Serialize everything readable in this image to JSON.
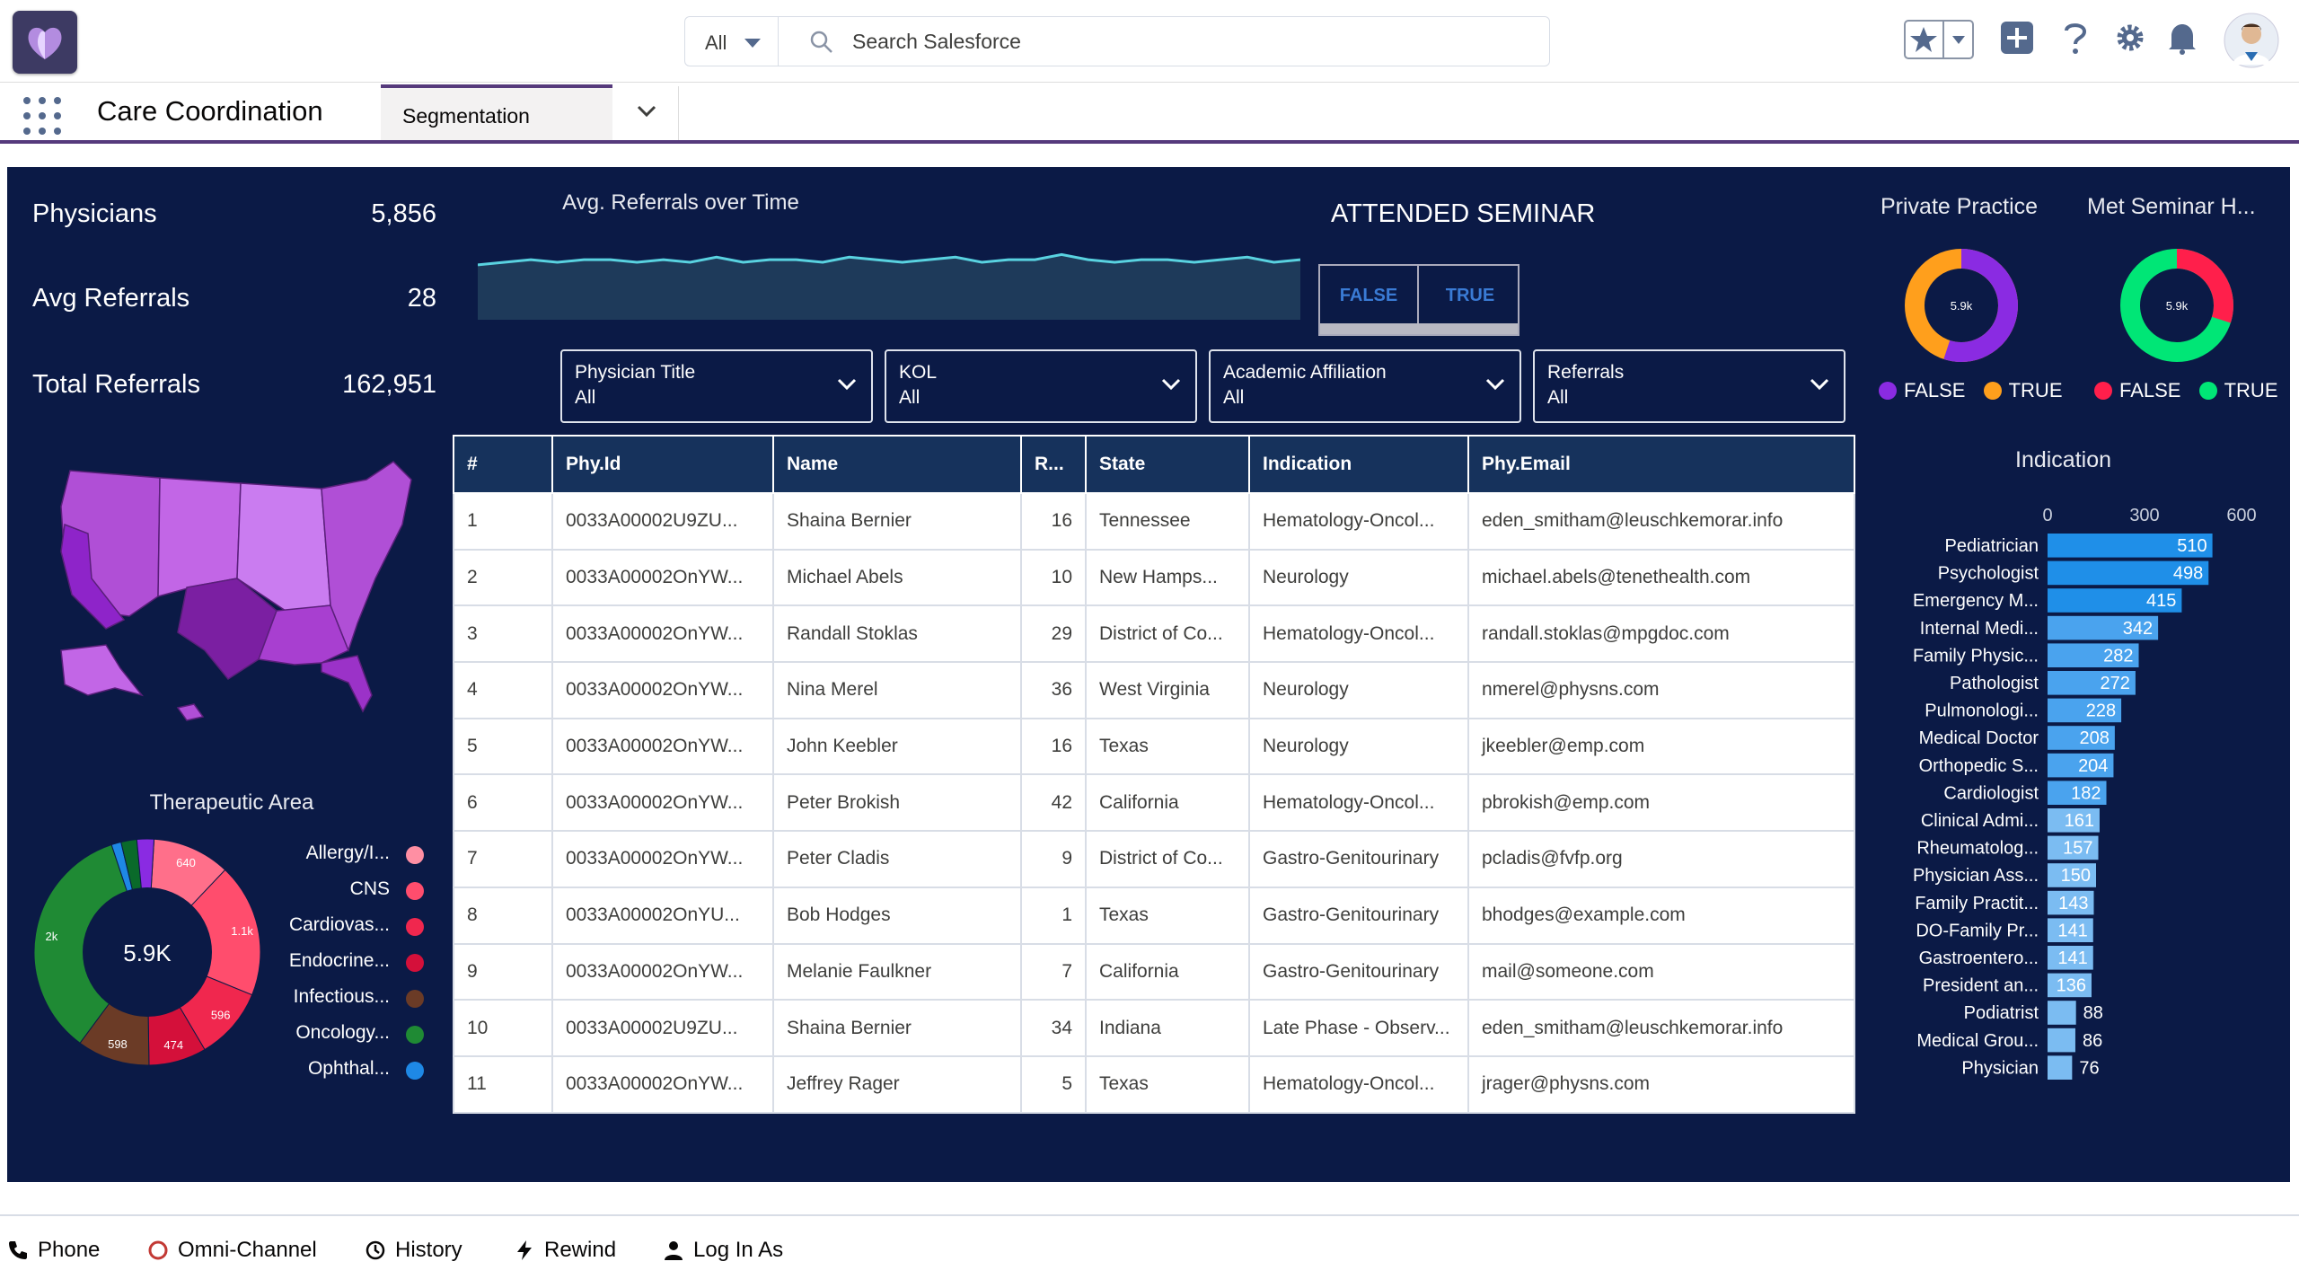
{
  "header": {
    "search_scope": "All",
    "search_placeholder": "Search Salesforce",
    "icons": [
      "favorites-icon",
      "add-icon",
      "help-icon",
      "setup-gear-icon",
      "notifications-bell-icon",
      "user-avatar"
    ]
  },
  "nav": {
    "app_name": "Care Coordination",
    "tab_label": "Segmentation"
  },
  "kpis": [
    {
      "label": "Physicians",
      "value": "5,856"
    },
    {
      "label": "Avg Referrals",
      "value": "28"
    },
    {
      "label": "Total Referrals",
      "value": "162,951"
    }
  ],
  "trend": {
    "title": "Avg. Referrals over Time",
    "values": [
      26,
      27,
      28,
      27,
      28,
      28,
      27,
      28,
      27,
      29,
      27,
      28,
      28,
      27,
      29,
      28,
      27,
      28,
      29,
      27,
      28,
      28,
      30,
      28,
      27,
      28,
      28,
      27,
      28,
      29,
      27,
      28
    ],
    "line_color": "#59d2e0",
    "fill_color": "#1e3a5a"
  },
  "seminar": {
    "title": "ATTENDED SEMINAR",
    "false_label": "FALSE",
    "true_label": "TRUE"
  },
  "filters": [
    {
      "label": "Physician Title",
      "value": "All"
    },
    {
      "label": "KOL",
      "value": "All"
    },
    {
      "label": "Academic Affiliation",
      "value": "All"
    },
    {
      "label": "Referrals",
      "value": "All"
    }
  ],
  "table": {
    "columns": [
      "#",
      "Phy.Id",
      "Name",
      "R...",
      "State",
      "Indication",
      "Phy.Email"
    ],
    "rows": [
      [
        "1",
        "0033A00002U9ZU...",
        "Shaina Bernier",
        "16",
        "Tennessee",
        "Hematology-Oncol...",
        "eden_smitham@leuschkemorar.info"
      ],
      [
        "2",
        "0033A00002OnYW...",
        "Michael Abels",
        "10",
        "New Hamps...",
        "Neurology",
        "michael.abels@tenethealth.com"
      ],
      [
        "3",
        "0033A00002OnYW...",
        "Randall Stoklas",
        "29",
        "District of Co...",
        "Hematology-Oncol...",
        "randall.stoklas@mpgdoc.com"
      ],
      [
        "4",
        "0033A00002OnYW...",
        "Nina Merel",
        "36",
        "West Virginia",
        "Neurology",
        "nmerel@physns.com"
      ],
      [
        "5",
        "0033A00002OnYW...",
        "John Keebler",
        "16",
        "Texas",
        "Neurology",
        "jkeebler@emp.com"
      ],
      [
        "6",
        "0033A00002OnYW...",
        "Peter Brokish",
        "42",
        "California",
        "Hematology-Oncol...",
        "pbrokish@emp.com"
      ],
      [
        "7",
        "0033A00002OnYW...",
        "Peter Cladis",
        "9",
        "District of Co...",
        "Gastro-Genitourinary",
        "pcladis@fvfp.org"
      ],
      [
        "8",
        "0033A00002OnYU...",
        "Bob Hodges",
        "1",
        "Texas",
        "Gastro-Genitourinary",
        "bhodges@example.com"
      ],
      [
        "9",
        "0033A00002OnYW...",
        "Melanie Faulkner",
        "7",
        "California",
        "Gastro-Genitourinary",
        "mail@someone.com"
      ],
      [
        "10",
        "0033A00002U9ZU...",
        "Shaina Bernier",
        "34",
        "Indiana",
        "Late Phase - Observ...",
        "eden_smitham@leuschkemorar.info"
      ],
      [
        "11",
        "0033A00002OnYW...",
        "Jeffrey Rager",
        "5",
        "Texas",
        "Hematology-Oncol...",
        "jrager@physns.com"
      ]
    ]
  },
  "therapeutic_area": {
    "title": "Therapeutic Area",
    "center_label": "5.9K",
    "slices": [
      {
        "name": "Allergy/I...",
        "value": 640,
        "label": "640",
        "color": "#ff6f8a"
      },
      {
        "name": "CNS",
        "value": 1100,
        "label": "1.1k",
        "color": "#ff4d6d"
      },
      {
        "name": "Cardiovas...",
        "value": 596,
        "label": "596",
        "color": "#f0274e"
      },
      {
        "name": "Endocrine...",
        "value": 474,
        "label": "474",
        "color": "#d4103a"
      },
      {
        "name": "Infectious...",
        "value": 598,
        "label": "598",
        "color": "#6b3b26"
      },
      {
        "name": "Oncology...",
        "value": 2000,
        "label": "2k",
        "color": "#1f8a34"
      },
      {
        "name": "Ophthal...",
        "value": 80,
        "label": "",
        "color": "#1e88e5"
      },
      {
        "name": "",
        "value": 130,
        "label": "",
        "color": "#0a6a2a"
      },
      {
        "name": "",
        "value": 140,
        "label": "",
        "color": "#8a2be2"
      }
    ]
  },
  "private_practice": {
    "title": "Private Practice",
    "center_label": "5.9k",
    "false_label": "FALSE",
    "true_label": "TRUE",
    "false_color": "#8a2be2",
    "true_color": "#ff9f1c",
    "false_fraction": 0.55
  },
  "met_seminar": {
    "title": "Met Seminar H...",
    "center_label": "5.9k",
    "false_label": "FALSE",
    "true_label": "TRUE",
    "false_color": "#ff1f4b",
    "true_color": "#00e676",
    "false_fraction": 0.3
  },
  "chart_data": {
    "type": "bar",
    "title": "Indication",
    "orientation": "horizontal",
    "xlim": [
      0,
      600
    ],
    "xticks": [
      "0",
      "300",
      "600"
    ],
    "categories": [
      "Pediatrician",
      "Psychologist",
      "Emergency M...",
      "Internal Medi...",
      "Family Physic...",
      "Pathologist",
      "Pulmonologi...",
      "Medical Doctor",
      "Orthopedic S...",
      "Cardiologist",
      "Clinical Admi...",
      "Rheumatolog...",
      "Physician Ass...",
      "Family Practit...",
      "DO-Family Pr...",
      "Gastroentero...",
      "President an...",
      "Podiatrist",
      "Medical Grou...",
      "Physician"
    ],
    "values": [
      510,
      498,
      415,
      342,
      282,
      272,
      228,
      208,
      204,
      182,
      161,
      157,
      150,
      143,
      141,
      141,
      136,
      88,
      86,
      76
    ]
  },
  "footer": {
    "items": [
      {
        "label": "Phone",
        "icon": "phone-icon"
      },
      {
        "label": "Omni-Channel",
        "icon": "omni-channel-icon"
      },
      {
        "label": "History",
        "icon": "history-icon"
      },
      {
        "label": "Rewind",
        "icon": "rewind-icon"
      },
      {
        "label": "Log In As",
        "icon": "user-icon"
      }
    ]
  }
}
